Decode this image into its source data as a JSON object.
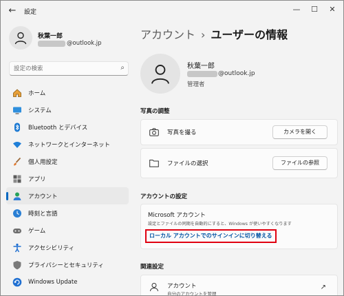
{
  "window": {
    "title": "設定",
    "back_icon": "back-arrow-icon",
    "controls": {
      "minimize": "—",
      "maximize": "☐",
      "close": "✕"
    }
  },
  "sidebar": {
    "user": {
      "name": "秋葉一郎",
      "email_suffix": "@outlook.jp"
    },
    "search": {
      "placeholder": "設定の検索"
    },
    "items": [
      {
        "label": "ホーム",
        "icon": "home-icon"
      },
      {
        "label": "システム",
        "icon": "system-icon"
      },
      {
        "label": "Bluetooth とデバイス",
        "icon": "bluetooth-icon"
      },
      {
        "label": "ネットワークとインターネット",
        "icon": "network-icon"
      },
      {
        "label": "個人用設定",
        "icon": "personalization-icon"
      },
      {
        "label": "アプリ",
        "icon": "apps-icon"
      },
      {
        "label": "アカウント",
        "icon": "accounts-icon",
        "active": true
      },
      {
        "label": "時刻と言語",
        "icon": "time-language-icon"
      },
      {
        "label": "ゲーム",
        "icon": "gaming-icon"
      },
      {
        "label": "アクセシビリティ",
        "icon": "accessibility-icon"
      },
      {
        "label": "プライバシーとセキュリティ",
        "icon": "privacy-icon"
      },
      {
        "label": "Windows Update",
        "icon": "windows-update-icon"
      }
    ]
  },
  "main": {
    "breadcrumb": {
      "parent": "アカウント",
      "separator": "›",
      "current": "ユーザーの情報"
    },
    "user": {
      "name": "秋葉一郎",
      "email_suffix": "@outlook.jp",
      "role": "管理者"
    },
    "photo_section": {
      "title": "写真の調整",
      "rows": [
        {
          "label": "写真を撮る",
          "button": "カメラを開く",
          "icon": "camera-icon"
        },
        {
          "label": "ファイルの選択",
          "button": "ファイルの参照",
          "icon": "folder-icon"
        }
      ]
    },
    "account_section": {
      "title": "アカウントの設定",
      "ms_title": "Microsoft アカウント",
      "ms_desc": "設定とファイルの同期を自動的にすると、Windows が使いやすくなります",
      "switch_link": "ローカル アカウントでのサインインに切り替える"
    },
    "related_section": {
      "title": "関連設定",
      "item_title": "アカウント",
      "item_sub": "自分のアカウントを管理"
    }
  },
  "colors": {
    "accent": "#0067c0",
    "highlight_border": "#e00010",
    "link": "#0052a3"
  }
}
